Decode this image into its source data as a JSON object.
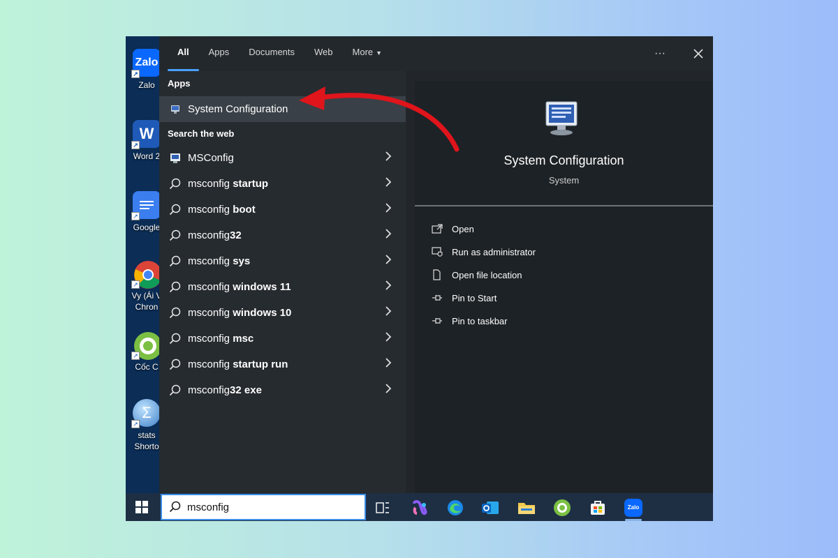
{
  "desktop": {
    "icons": [
      {
        "label": "Zalo",
        "icon": "zalo-icon"
      },
      {
        "label": "Word 2",
        "icon": "word-icon"
      },
      {
        "label": "Google",
        "icon": "google-docs-icon"
      },
      {
        "label": "Vy (Ái V",
        "label2": "Chron",
        "icon": "chrome-icon"
      },
      {
        "label": "Cốc C",
        "icon": "coccoc-icon"
      },
      {
        "label": "stats",
        "label2": "Shorto",
        "icon": "stats-icon"
      }
    ]
  },
  "tabs": [
    "All",
    "Apps",
    "Documents",
    "Web",
    "More"
  ],
  "active_tab": "All",
  "header": {
    "more_options": "···",
    "close": "✕"
  },
  "sections": {
    "apps": "Apps",
    "web": "Search the web"
  },
  "best_match": {
    "label": "System Configuration"
  },
  "web_results": [
    {
      "prefix": "MSConfig",
      "bold": ""
    },
    {
      "prefix": "msconfig ",
      "bold": "startup"
    },
    {
      "prefix": "msconfig ",
      "bold": "boot"
    },
    {
      "prefix": "msconfig",
      "bold": "32"
    },
    {
      "prefix": "msconfig ",
      "bold": "sys"
    },
    {
      "prefix": "msconfig ",
      "bold": "windows 11"
    },
    {
      "prefix": "msconfig ",
      "bold": "windows 10"
    },
    {
      "prefix": "msconfig ",
      "bold": "msc"
    },
    {
      "prefix": "msconfig ",
      "bold": "startup run"
    },
    {
      "prefix": "msconfig",
      "bold": "32 exe"
    }
  ],
  "detail": {
    "title": "System Configuration",
    "subtitle": "System",
    "actions": [
      "Open",
      "Run as administrator",
      "Open file location",
      "Pin to Start",
      "Pin to taskbar"
    ]
  },
  "taskbar": {
    "search_value": "msconfig",
    "apps": [
      "task-view-icon",
      "copilot-icon",
      "edge-icon",
      "outlook-icon",
      "file-explorer-icon",
      "coccoc-icon",
      "store-icon",
      "zalo-icon"
    ],
    "zalo_label": "Zalo"
  },
  "colors": {
    "accent": "#4aa0ff",
    "arrow": "#e0141b",
    "panel": "#22262b",
    "taskbar": "#1e2f44"
  }
}
